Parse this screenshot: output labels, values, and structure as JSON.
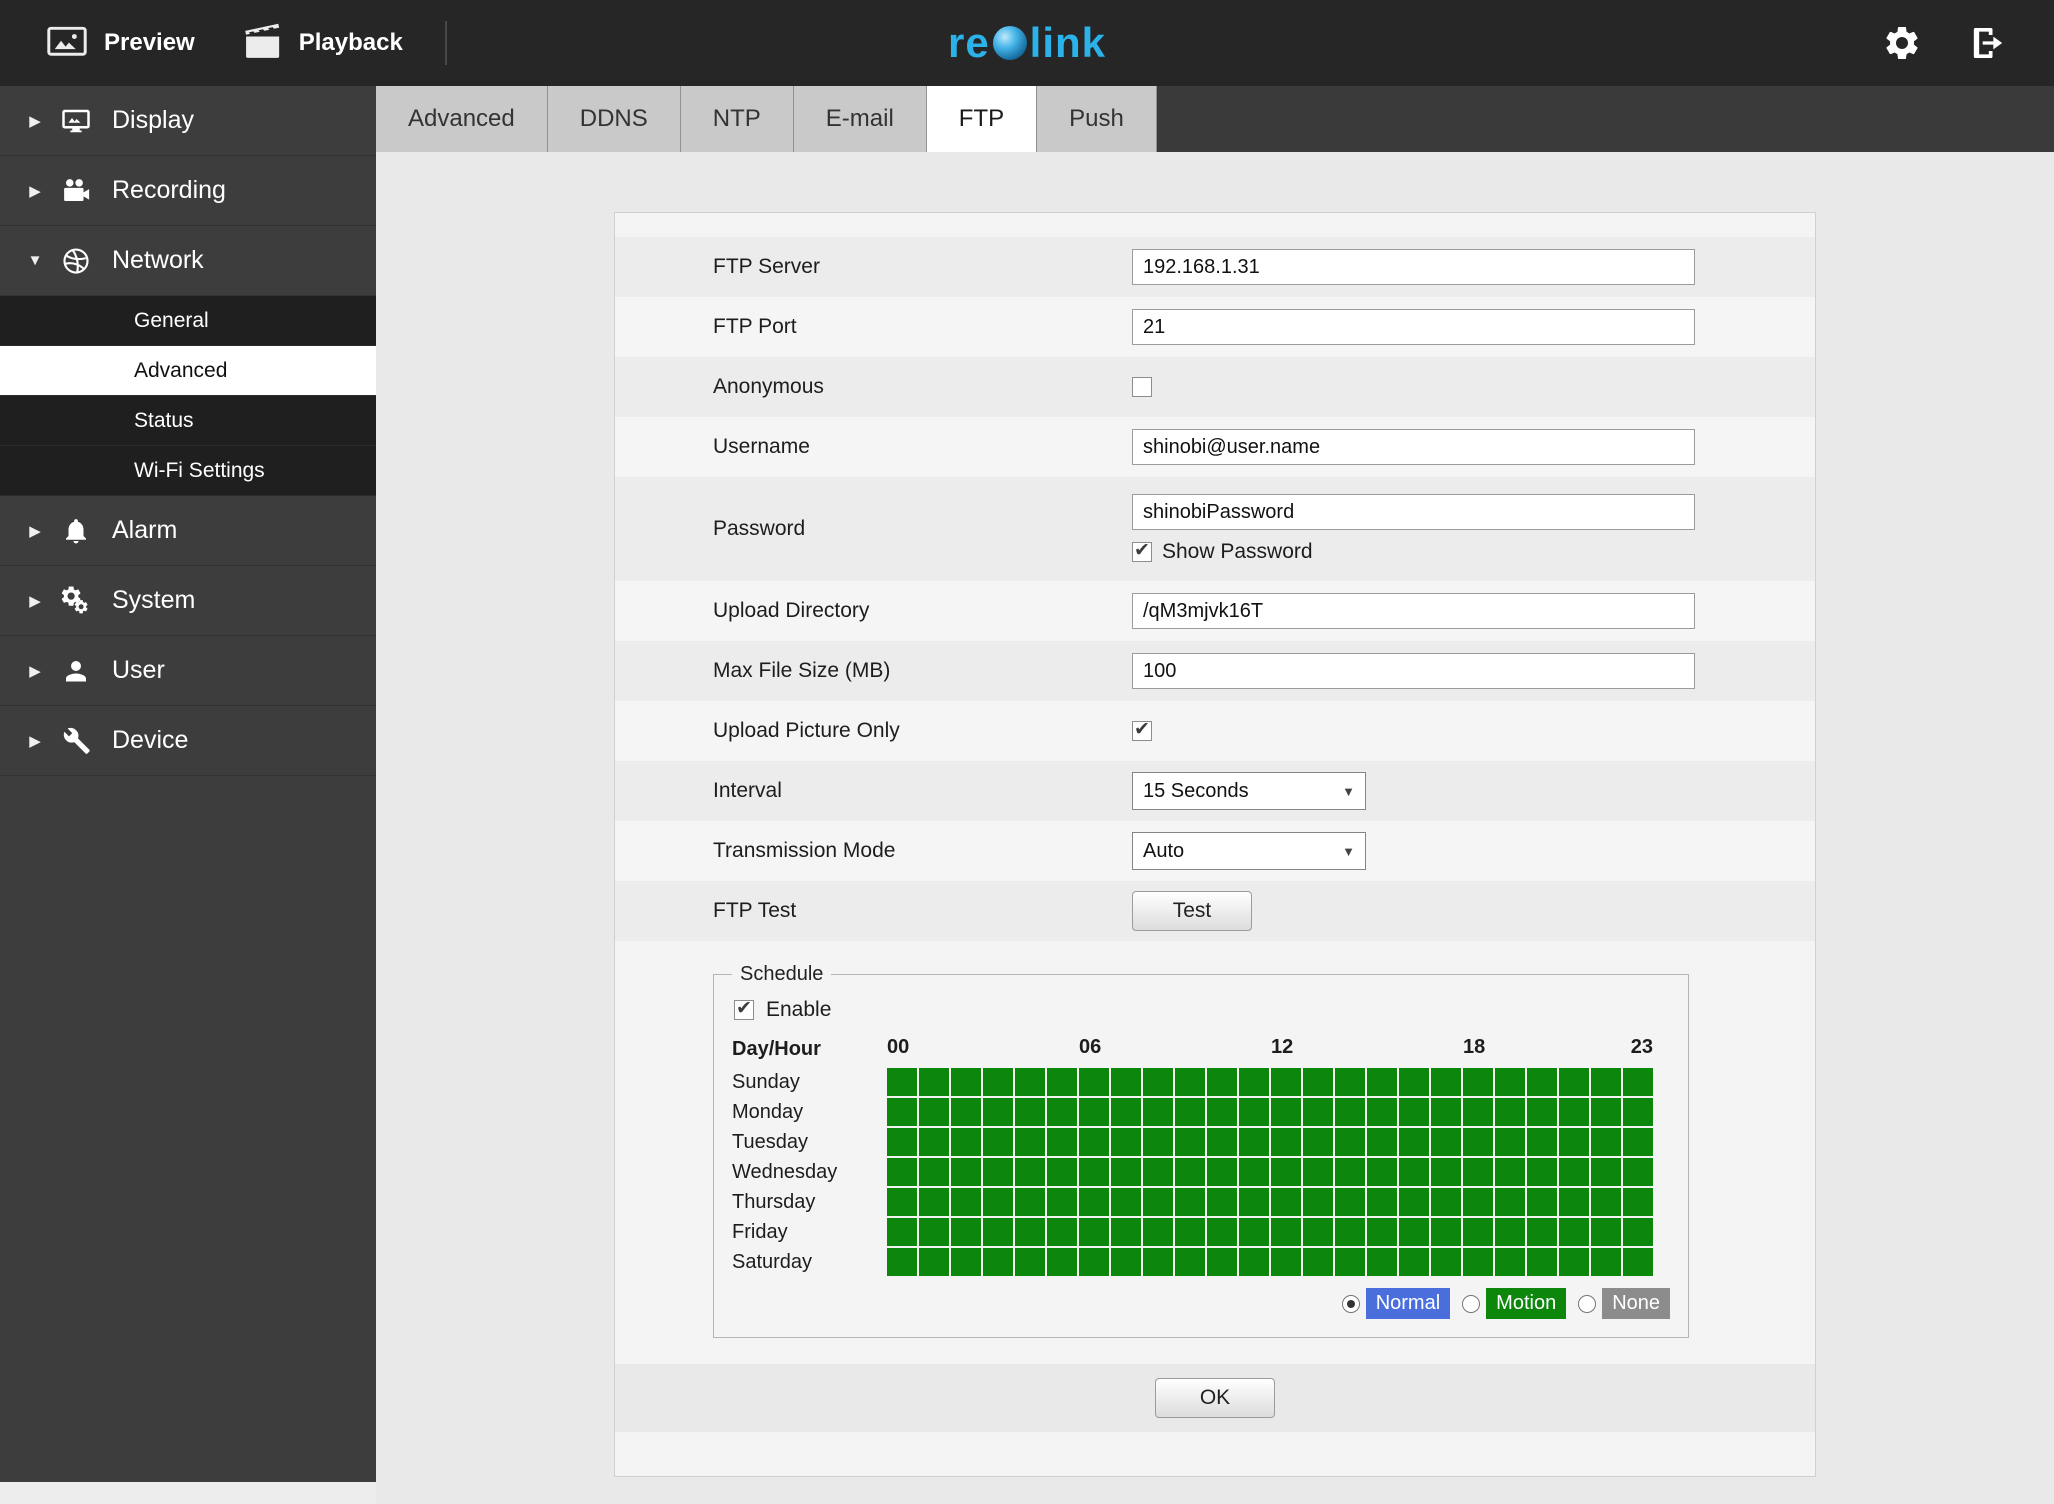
{
  "topbar": {
    "preview_label": "Preview",
    "playback_label": "Playback",
    "logo_text": "reolink",
    "logo_color": "#2bb2e8"
  },
  "sidebar": {
    "items": [
      {
        "label": "Display",
        "icon": "display-icon",
        "state": "collapsed"
      },
      {
        "label": "Recording",
        "icon": "recording-icon",
        "state": "collapsed"
      },
      {
        "label": "Network",
        "icon": "network-icon",
        "state": "expanded",
        "children": [
          {
            "label": "General",
            "active": false
          },
          {
            "label": "Advanced",
            "active": true
          },
          {
            "label": "Status",
            "active": false
          },
          {
            "label": "Wi-Fi Settings",
            "active": false
          }
        ]
      },
      {
        "label": "Alarm",
        "icon": "alarm-icon",
        "state": "collapsed"
      },
      {
        "label": "System",
        "icon": "system-icon",
        "state": "collapsed"
      },
      {
        "label": "User",
        "icon": "user-icon",
        "state": "collapsed"
      },
      {
        "label": "Device",
        "icon": "device-icon",
        "state": "collapsed"
      }
    ]
  },
  "tabs": {
    "items": [
      "Advanced",
      "DDNS",
      "NTP",
      "E-mail",
      "FTP",
      "Push"
    ],
    "active": "FTP"
  },
  "form": {
    "rows": [
      {
        "label": "FTP Server",
        "type": "text",
        "value": "192.168.1.31"
      },
      {
        "label": "FTP Port",
        "type": "text",
        "value": "21"
      },
      {
        "label": "Anonymous",
        "type": "checkbox",
        "checked": false
      },
      {
        "label": "Username",
        "type": "text",
        "value": "shinobi@user.name"
      },
      {
        "label": "Password",
        "type": "text_with_checkbox",
        "value": "shinobiPassword",
        "checkbox_label": "Show Password",
        "checkbox_checked": true
      },
      {
        "label": "Upload Directory",
        "type": "text",
        "value": "/qM3mjvk16T"
      },
      {
        "label": "Max File Size (MB)",
        "type": "text",
        "value": "100"
      },
      {
        "label": "Upload Picture Only",
        "type": "checkbox",
        "checked": true
      },
      {
        "label": "Interval",
        "type": "select",
        "value": "15 Seconds"
      },
      {
        "label": "Transmission Mode",
        "type": "select",
        "value": "Auto"
      },
      {
        "label": "FTP Test",
        "type": "button",
        "value": "Test"
      }
    ]
  },
  "schedule": {
    "legend": "Schedule",
    "enable_label": "Enable",
    "enable_checked": true,
    "day_hour_label": "Day/Hour",
    "hour_labels": [
      {
        "text": "00",
        "col": 0
      },
      {
        "text": "06",
        "col": 6
      },
      {
        "text": "12",
        "col": 12
      },
      {
        "text": "18",
        "col": 18
      },
      {
        "text": "23",
        "col": 23
      }
    ],
    "days": [
      "Sunday",
      "Monday",
      "Tuesday",
      "Wednesday",
      "Thursday",
      "Friday",
      "Saturday"
    ],
    "hours_per_day": 24,
    "all_cells_on": true,
    "cell_on_color": "#0c870c",
    "modes": [
      {
        "label": "Normal",
        "color": "#4a6fdc",
        "selected": true
      },
      {
        "label": "Motion",
        "color": "#0c870c",
        "selected": false
      },
      {
        "label": "None",
        "color": "#8c8c8c",
        "selected": false
      }
    ]
  },
  "footer": {
    "ok_label": "OK"
  }
}
